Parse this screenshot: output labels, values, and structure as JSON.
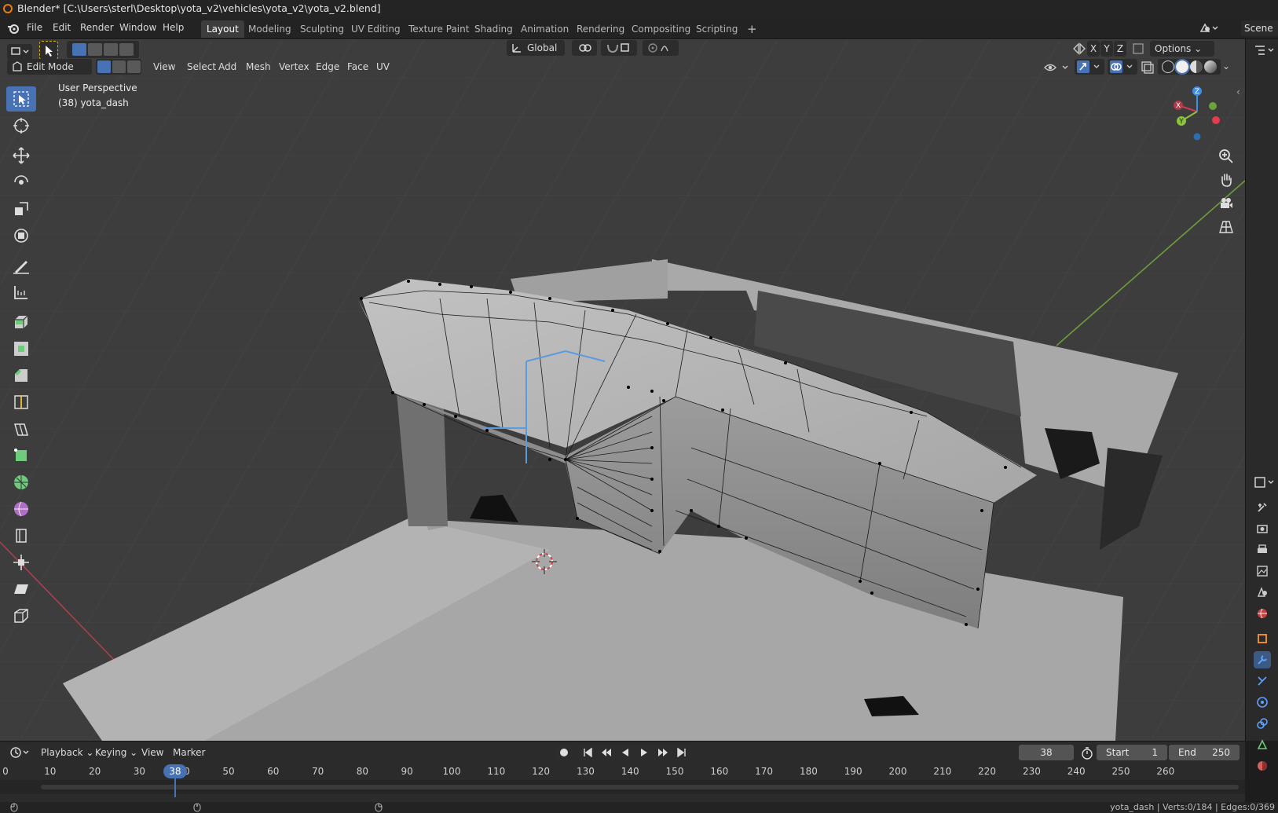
{
  "window": {
    "title": "Blender* [C:\\Users\\sterl\\Desktop\\yota_v2\\vehicles\\yota_v2\\yota_v2.blend]"
  },
  "menus": {
    "file": "File",
    "edit": "Edit",
    "render": "Render",
    "window": "Window",
    "help": "Help"
  },
  "workspaces": {
    "tabs": [
      {
        "label": "Layout",
        "active": true
      },
      {
        "label": "Modeling"
      },
      {
        "label": "Sculpting"
      },
      {
        "label": "UV Editing"
      },
      {
        "label": "Texture Paint"
      },
      {
        "label": "Shading"
      },
      {
        "label": "Animation"
      },
      {
        "label": "Rendering"
      },
      {
        "label": "Compositing"
      },
      {
        "label": "Scripting"
      }
    ],
    "add": "+",
    "scene": "Scene"
  },
  "tool_header": {
    "transform_orientation": "Global",
    "axis_x": "X",
    "axis_y": "Y",
    "axis_z": "Z",
    "options": "Options"
  },
  "viewport_header": {
    "mode": "Edit Mode",
    "view": "View",
    "select": "Select",
    "add": "Add",
    "mesh": "Mesh",
    "vertex": "Vertex",
    "edge": "Edge",
    "face": "Face",
    "uv": "UV"
  },
  "viewport": {
    "perspective_label": "User Perspective",
    "object_label": "(38) yota_dash",
    "gizmo": {
      "x": "X",
      "y": "Y",
      "z": "Z"
    }
  },
  "timeline": {
    "playback": "Playback",
    "keying": "Keying",
    "view": "View",
    "marker": "Marker",
    "current_frame": "38",
    "start_label": "Start",
    "start_value": "1",
    "end_label": "End",
    "end_value": "250",
    "ruler": [
      "0",
      "10",
      "20",
      "30",
      "40",
      "50",
      "60",
      "70",
      "80",
      "90",
      "100",
      "110",
      "120",
      "130",
      "140",
      "150",
      "160",
      "170",
      "180",
      "190",
      "200",
      "210",
      "220",
      "230",
      "240",
      "250",
      "260"
    ]
  },
  "statusbar": {
    "stats": "yota_dash | Verts:0/184 | Edges:0/369"
  },
  "colors": {
    "accent": "#4772b3",
    "axis_x": "#d6384d",
    "axis_y": "#8bc43a",
    "axis_z": "#3b8fe6",
    "header_bg": "#2b2b2b",
    "viewport_bg": "#3d3d3d"
  }
}
